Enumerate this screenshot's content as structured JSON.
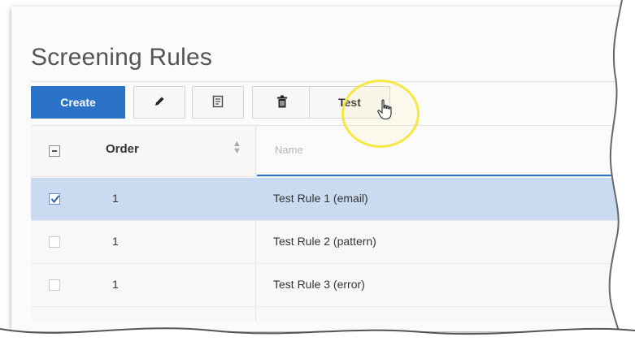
{
  "page": {
    "title": "Screening Rules"
  },
  "toolbar": {
    "create_label": "Create",
    "edit_icon": "pencil-icon",
    "copy_icon": "copy-icon",
    "delete_icon": "trash-icon",
    "test_label": "Test"
  },
  "grid": {
    "columns": {
      "order": "Order",
      "name_placeholder": "Name"
    },
    "rows": [
      {
        "order": "1",
        "name": "Test Rule 1 (email)",
        "selected": true
      },
      {
        "order": "1",
        "name": "Test Rule 2 (pattern)",
        "selected": false
      },
      {
        "order": "1",
        "name": "Test Rule 3 (error)",
        "selected": false
      }
    ]
  },
  "colors": {
    "accent": "#2b72c9",
    "selected_row": "#c9daf1",
    "highlight": "#f3e844"
  }
}
